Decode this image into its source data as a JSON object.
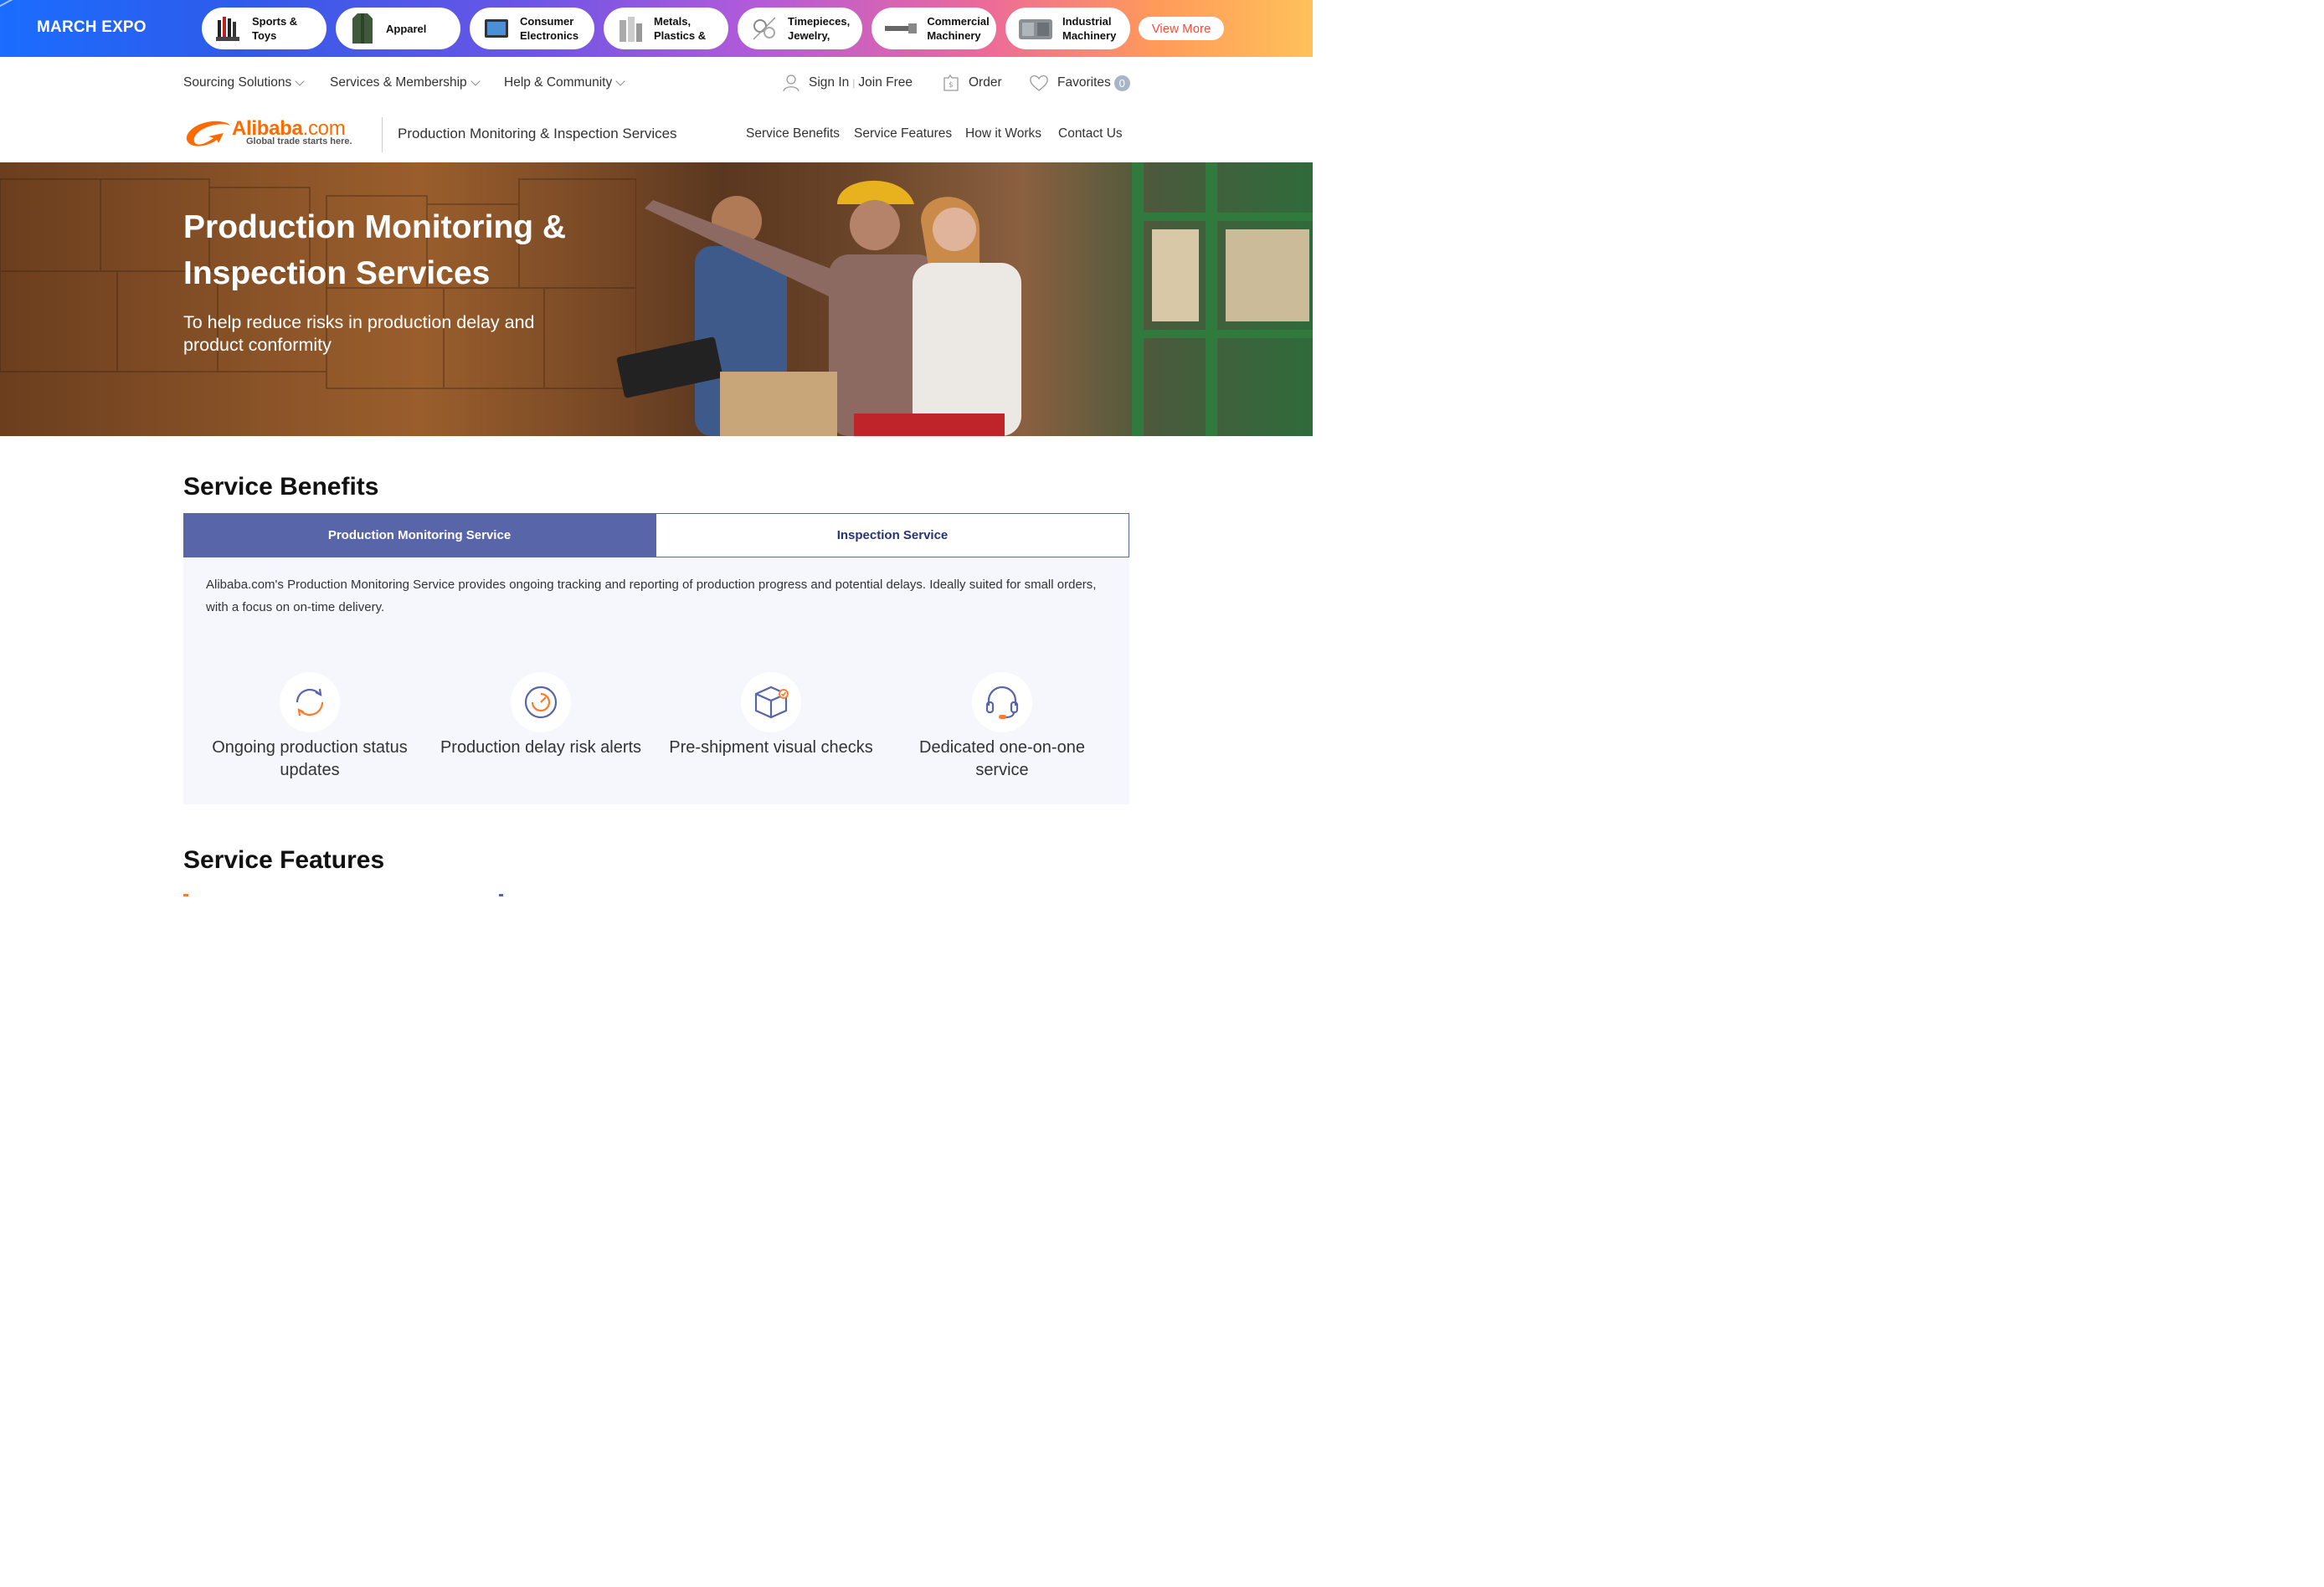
{
  "expo": {
    "title": "MARCH EXPO",
    "categories": [
      {
        "label": "Sports & Toys",
        "icon": "sports-toys-thumbnail"
      },
      {
        "label": "Apparel",
        "icon": "apparel-thumbnail"
      },
      {
        "label": "Consumer Electronics",
        "icon": "consumer-electronics-thumbnail"
      },
      {
        "label": "Metals, Plastics &",
        "icon": "metals-plastics-thumbnail"
      },
      {
        "label": "Timepieces, Jewelry,",
        "icon": "timepieces-jewelry-thumbnail"
      },
      {
        "label": "Commercial Machinery",
        "icon": "commercial-machinery-thumbnail"
      },
      {
        "label": "Industrial Machinery",
        "icon": "industrial-machinery-thumbnail"
      }
    ],
    "view_more": "View More"
  },
  "topnav": {
    "sourcing": "Sourcing Solutions",
    "services": "Services & Membership",
    "help": "Help & Community",
    "sign_in": "Sign In",
    "join_free": "Join Free",
    "order": "Order",
    "favorites": "Favorites",
    "favorites_count": "0"
  },
  "header": {
    "logo_text": "Alibaba",
    "logo_suffix": ".com",
    "logo_tagline": "Global trade starts here.",
    "page_subtitle": "Production Monitoring & Inspection Services",
    "secnav": [
      "Service Benefits",
      "Service Features",
      "How it Works",
      "Contact Us"
    ]
  },
  "hero": {
    "title": "Production Monitoring & Inspection Services",
    "subtitle": "To help reduce risks in production delay and product conformity"
  },
  "benefits": {
    "heading": "Service Benefits",
    "tabs": [
      "Production Monitoring Service",
      "Inspection Service"
    ],
    "active_tab": 0,
    "description": "Alibaba.com's Production Monitoring Service provides ongoing tracking and reporting of production progress and potential delays. Ideally suited for small orders, with a focus on on-time delivery.",
    "items": [
      {
        "label": "Ongoing production status updates",
        "icon": "refresh-icon"
      },
      {
        "label": "Production delay risk alerts",
        "icon": "timer-icon"
      },
      {
        "label": "Pre-shipment visual checks",
        "icon": "box-check-icon"
      },
      {
        "label": "Dedicated one-on-one service",
        "icon": "headset-icon"
      }
    ]
  },
  "features": {
    "heading": "Service Features"
  },
  "colors": {
    "brand_orange": "#ff6a00",
    "tab_active": "#5865a8",
    "tab_text": "#263378",
    "panel_bg": "#f6f7fc",
    "view_more_text": "#ff4a3a"
  }
}
